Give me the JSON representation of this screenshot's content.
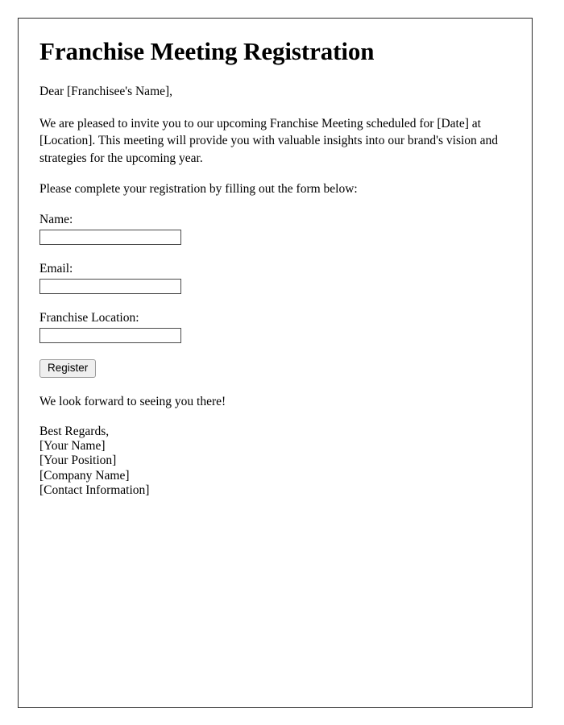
{
  "document": {
    "title": "Franchise Meeting Registration",
    "greeting": "Dear [Franchisee's Name],",
    "intro_paragraph": "We are pleased to invite you to our upcoming Franchise Meeting scheduled for [Date] at [Location]. This meeting will provide you with valuable insights into our brand's vision and strategies for the upcoming year.",
    "instruction_paragraph": "Please complete your registration by filling out the form below:",
    "closing_line": "We look forward to seeing you there!"
  },
  "form": {
    "fields": [
      {
        "label": "Name:",
        "value": "",
        "placeholder": ""
      },
      {
        "label": "Email:",
        "value": "",
        "placeholder": ""
      },
      {
        "label": "Franchise Location:",
        "value": "",
        "placeholder": ""
      }
    ],
    "submit_label": "Register"
  },
  "signature": {
    "lines": [
      "Best Regards,",
      "[Your Name]",
      "[Your Position]",
      "[Company Name]",
      "[Contact Information]"
    ]
  },
  "style": {
    "page_border_color": "#2b2b2b",
    "text_color": "#000000",
    "input_border_color": "#4a4a4a",
    "button_background": "#efefef",
    "button_border_color": "#9a9a9a",
    "page_background": "#ffffff"
  }
}
